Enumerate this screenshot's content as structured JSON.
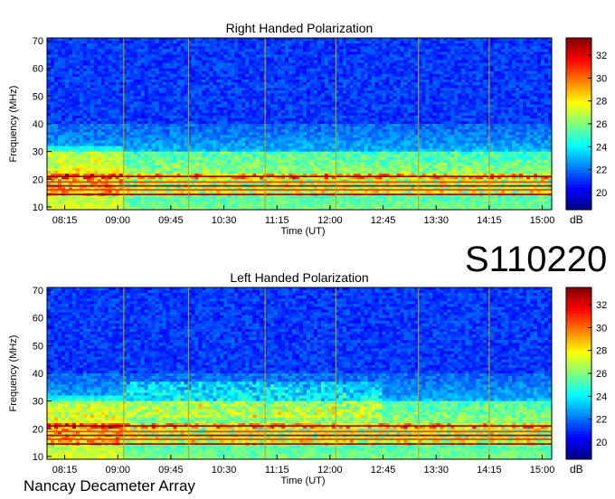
{
  "figure_label": "S110220",
  "footer_text": "Nancay Decameter Array",
  "colors": {
    "background_low": "#00007f",
    "event_line": "#c8a000",
    "axis": "#000000"
  },
  "colormap": [
    "#00007f",
    "#0000ff",
    "#007fff",
    "#00ffff",
    "#7fff7f",
    "#ffff00",
    "#ff7f00",
    "#ff0000",
    "#7f0000"
  ],
  "chart_data": [
    {
      "type": "heatmap",
      "title": "Right Handed Polarization",
      "xlabel": "Time (UT)",
      "ylabel": "Frequency (MHz)",
      "xlim": [
        "08:00",
        "15:08"
      ],
      "ylim": [
        9,
        71
      ],
      "x_ticks": [
        "08:15",
        "09:00",
        "09:45",
        "10:30",
        "11:15",
        "12:00",
        "12:45",
        "13:30",
        "14:15",
        "15:00"
      ],
      "y_ticks": [
        10,
        20,
        30,
        40,
        50,
        60,
        70
      ],
      "colorbar": {
        "label": "dB",
        "range": [
          18.5,
          33.5
        ],
        "ticks": [
          20,
          22,
          24,
          26,
          28,
          30,
          32
        ]
      },
      "vertical_lines": [
        "09:05",
        "10:00",
        "11:05",
        "12:05",
        "13:15",
        "14:15"
      ]
    },
    {
      "type": "heatmap",
      "title": "Left Handed Polarization",
      "xlabel": "Time (UT)",
      "ylabel": "Frequency (MHz)",
      "xlim": [
        "08:00",
        "15:08"
      ],
      "ylim": [
        9,
        71
      ],
      "x_ticks": [
        "08:15",
        "09:00",
        "09:45",
        "10:30",
        "11:15",
        "12:00",
        "12:45",
        "13:30",
        "14:15",
        "15:00"
      ],
      "y_ticks": [
        10,
        20,
        30,
        40,
        50,
        60,
        70
      ],
      "colorbar": {
        "label": "dB",
        "range": [
          18.5,
          33.5
        ],
        "ticks": [
          20,
          22,
          24,
          26,
          28,
          30,
          32
        ]
      },
      "vertical_lines": [
        "09:05",
        "10:00",
        "11:05",
        "12:05",
        "13:15",
        "14:15"
      ]
    }
  ]
}
